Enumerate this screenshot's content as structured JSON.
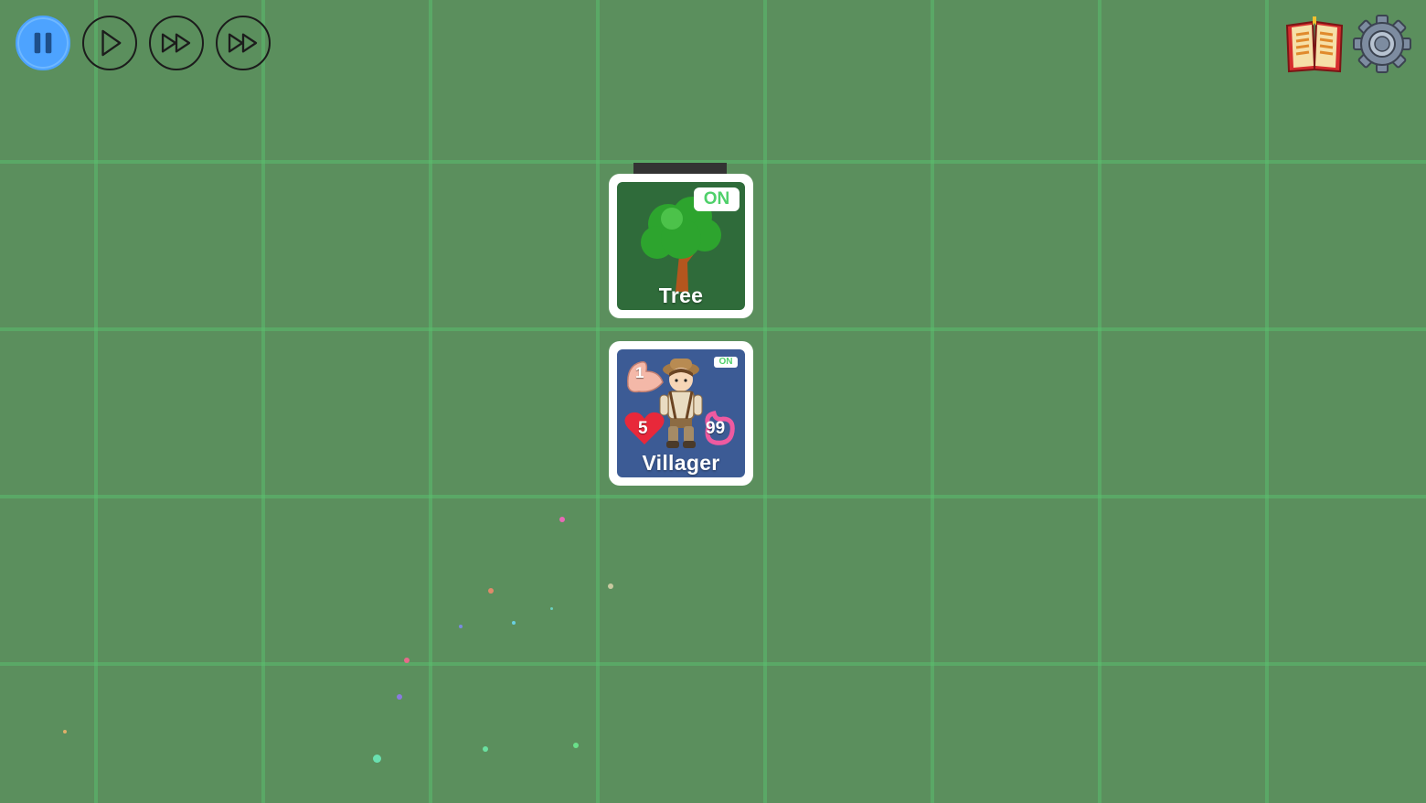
{
  "controls": {
    "pause": {
      "icon": "pause-icon",
      "state": "active"
    },
    "play": {
      "icon": "play-icon"
    },
    "fast_forward": {
      "icon": "fast-forward-icon"
    },
    "faster_forward": {
      "icon": "fast-forward-icon"
    }
  },
  "toolbar": {
    "recipe_book": {
      "icon": "open-book-icon"
    },
    "settings": {
      "icon": "gear-icon"
    }
  },
  "cards": {
    "tree": {
      "name": "Tree",
      "toggle": "ON",
      "color": "#2f6b3a"
    },
    "villager": {
      "name": "Villager",
      "toggle": "ON",
      "strength": "1",
      "health": "5",
      "food": "99",
      "color": "#3c5b95"
    }
  },
  "colors": {
    "board": "#5b8f5d",
    "grid": "#5abe6e",
    "active_control": "#4da3ff",
    "toggle_text": "#4fd06a"
  }
}
